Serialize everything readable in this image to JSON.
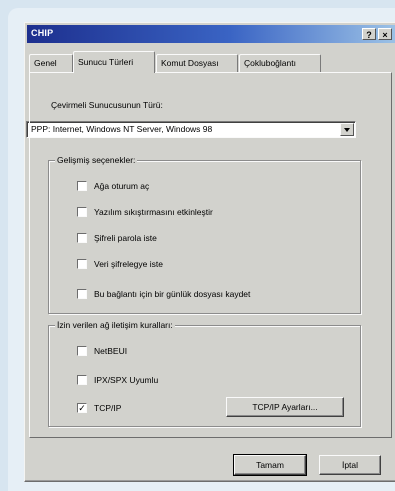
{
  "window": {
    "title": "CHIP",
    "help_label": "?",
    "close_label": "×"
  },
  "tabs": [
    {
      "label": "Genel"
    },
    {
      "label": "Sunucu Türleri"
    },
    {
      "label": "Komut Dosyası"
    },
    {
      "label": "Çokluboğlantı"
    }
  ],
  "server_type": {
    "label": "Çevirmeli Sunucusunun Türü:",
    "selected": "PPP: Internet, Windows NT Server, Windows 98"
  },
  "advanced": {
    "title": "Gelişmiş seçenekler:",
    "options": [
      {
        "label": "Ağa oturum aç",
        "checked": false
      },
      {
        "label": "Yazılım sıkıştırmasını etkinleştir",
        "checked": false
      },
      {
        "label": "Şifreli parola iste",
        "checked": false
      },
      {
        "label": "Veri şifrelegye iste",
        "checked": false
      },
      {
        "label": "Bu bağlantı için bir günlük dosyası kaydet",
        "checked": false
      }
    ]
  },
  "protocols": {
    "title": "İzin verilen ağ iletişim kuralları:",
    "options": [
      {
        "label": "NetBEUI",
        "checked": false
      },
      {
        "label": "IPX/SPX Uyumlu",
        "checked": false
      },
      {
        "label": "TCP/IP",
        "checked": true
      }
    ],
    "tcp_button": "TCP/IP Ayarları..."
  },
  "footer": {
    "ok": "Tamam",
    "cancel": "İptal"
  }
}
